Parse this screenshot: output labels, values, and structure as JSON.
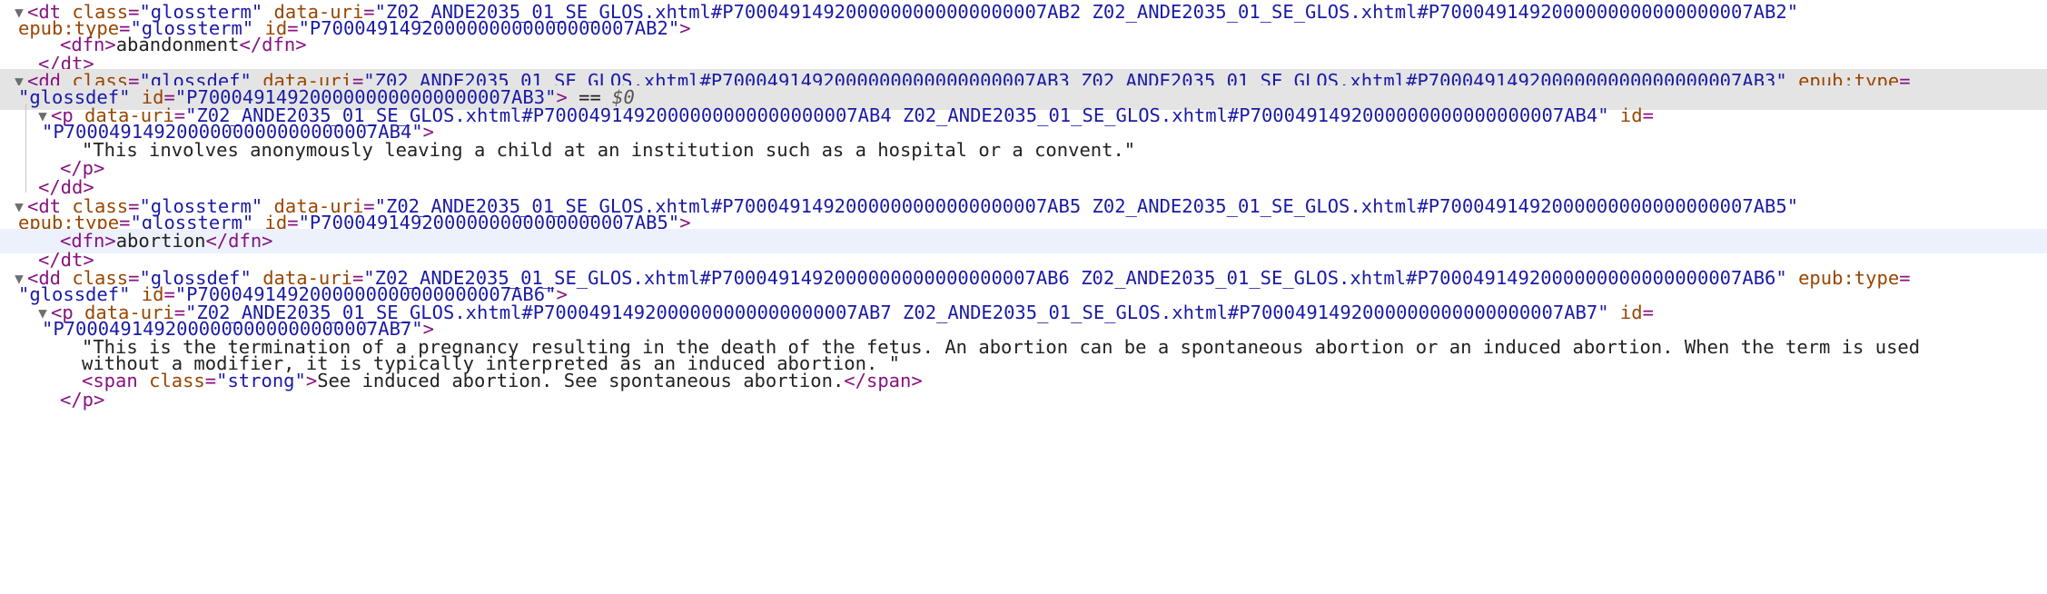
{
  "colors": {
    "tag": "#881280",
    "attribute_name": "#994500",
    "attribute_value": "#1a1aa6",
    "text": "#222222",
    "selected_row_bg": "#e4e4e4",
    "hovered_row_bg": "#edf1fb",
    "disclosure_triangle": "#6e6e6e"
  },
  "icons": {
    "expanded_node": "triangle-down-icon"
  },
  "dom_tree": {
    "dt_open_1": {
      "open": "<dt",
      "attr_class": "class",
      "eq1": "=",
      "val_class": "\"glossterm\"",
      "attr_uri": "data-uri",
      "eq2": "=",
      "val_uri": "\"Z02_ANDE2035_01_SE_GLOS.xhtml#P7000491492000000000000000007AB2 Z02_ANDE2035_01_SE_GLOS.xhtml#P7000491492000000000000000007AB2\""
    },
    "dt_open_1_cont": {
      "attr_type": "epub:type",
      "eq1": "=",
      "val_type": "\"glossterm\"",
      "attr_id": "id",
      "eq2": "=",
      "val_id": "\"P7000491492000000000000000007AB2\"",
      "close": ">"
    },
    "dfn_1": {
      "open": "<dfn>",
      "text": "abandonment",
      "close": "</dfn>"
    },
    "dt_close_1": "</dt>",
    "dd_open_1": {
      "open": "<dd",
      "attr_class": "class",
      "eq1": "=",
      "val_class": "\"glossdef\"",
      "attr_uri": "data-uri",
      "eq2": "=",
      "val_uri": "\"Z02_ANDE2035_01_SE_GLOS.xhtml#P7000491492000000000000000007AB3 Z02_ANDE2035_01_SE_GLOS.xhtml#P7000491492000000000000000007AB3\"",
      "attr_type": "epub:type",
      "eq3": "="
    },
    "dd_open_1_cont": {
      "val_type": "\"glossdef\"",
      "attr_id": "id",
      "eq1": "=",
      "val_id": "\"P7000491492000000000000000007AB3\"",
      "close": ">",
      "selection_marker": " == ",
      "dollar": "$0"
    },
    "p_open_1": {
      "open": "<p",
      "attr_uri": "data-uri",
      "eq1": "=",
      "val_uri": "\"Z02_ANDE2035_01_SE_GLOS.xhtml#P7000491492000000000000000007AB4 Z02_ANDE2035_01_SE_GLOS.xhtml#P7000491492000000000000000007AB4\"",
      "attr_id": "id",
      "eq2": "="
    },
    "p_open_1_cont": {
      "val_id": "\"P7000491492000000000000000007AB4\"",
      "close": ">"
    },
    "p_text_1": "\"This involves anonymously leaving a child at an institution such as a hospital or a convent.\"",
    "p_close_1": "</p>",
    "dd_close_1": "</dd>",
    "dt_open_2": {
      "open": "<dt",
      "attr_class": "class",
      "eq1": "=",
      "val_class": "\"glossterm\"",
      "attr_uri": "data-uri",
      "eq2": "=",
      "val_uri": "\"Z02_ANDE2035_01_SE_GLOS.xhtml#P7000491492000000000000000007AB5 Z02_ANDE2035_01_SE_GLOS.xhtml#P7000491492000000000000000007AB5\""
    },
    "dt_open_2_cont": {
      "attr_type": "epub:type",
      "eq1": "=",
      "val_type": "\"glossterm\"",
      "attr_id": "id",
      "eq2": "=",
      "val_id": "\"P7000491492000000000000000007AB5\"",
      "close": ">"
    },
    "dfn_2": {
      "open": "<dfn>",
      "text": "abortion",
      "close": "</dfn>"
    },
    "dt_close_2": "</dt>",
    "dd_open_2": {
      "open": "<dd",
      "attr_class": "class",
      "eq1": "=",
      "val_class": "\"glossdef\"",
      "attr_uri": "data-uri",
      "eq2": "=",
      "val_uri": "\"Z02_ANDE2035_01_SE_GLOS.xhtml#P7000491492000000000000000007AB6 Z02_ANDE2035_01_SE_GLOS.xhtml#P7000491492000000000000000007AB6\"",
      "attr_type": "epub:type",
      "eq3": "="
    },
    "dd_open_2_cont": {
      "val_type": "\"glossdef\"",
      "attr_id": "id",
      "eq1": "=",
      "val_id": "\"P7000491492000000000000000007AB6\"",
      "close": ">"
    },
    "p_open_2": {
      "open": "<p",
      "attr_uri": "data-uri",
      "eq1": "=",
      "val_uri": "\"Z02_ANDE2035_01_SE_GLOS.xhtml#P7000491492000000000000000007AB7 Z02_ANDE2035_01_SE_GLOS.xhtml#P7000491492000000000000000007AB7\"",
      "attr_id": "id",
      "eq2": "="
    },
    "p_open_2_cont": {
      "val_id": "\"P7000491492000000000000000007AB7\"",
      "close": ">"
    },
    "p_text_2_line1": "\"This is the termination of a pregnancy resulting in the death of the fetus. An abortion can be a spontaneous abortion or an induced abortion. When the term is used",
    "p_text_2_line2": "without a modifier, it is typically interpreted as an induced abortion. \"",
    "span_1": {
      "open": "<span",
      "attr_class": "class",
      "eq1": "=",
      "val_class": "\"strong\"",
      "close": ">",
      "text": "See induced abortion. See spontaneous abortion.",
      "end": "</span>"
    },
    "p_close_2": "</p>"
  }
}
